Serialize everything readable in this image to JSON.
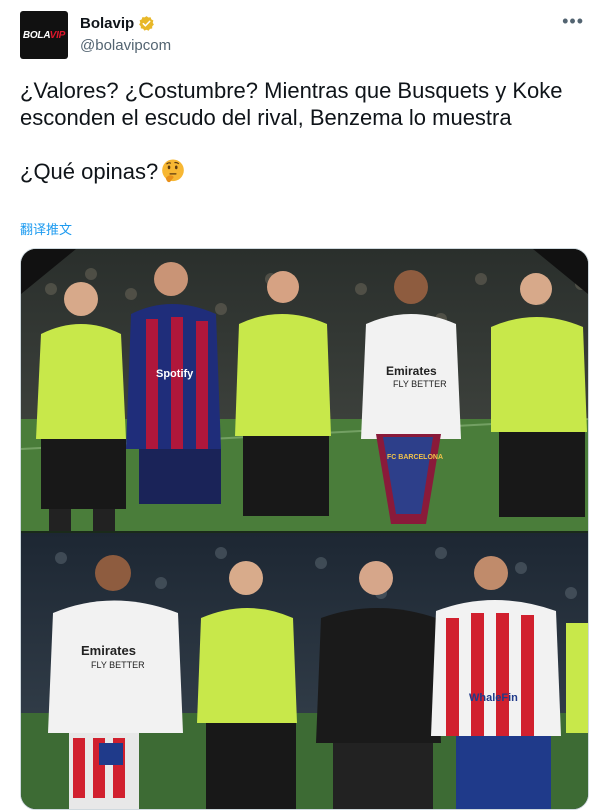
{
  "author": {
    "name": "Bolavip",
    "handle": "@bolavipcom",
    "avatar_text_a": "BOLA",
    "avatar_text_b": "VIP"
  },
  "tweet": {
    "text": "¿Valores? ¿Costumbre? Mientras que Busquets y Koke esconden el escudo del rival, Benzema lo muestra\n\n¿Qué opinas?",
    "translate_label": "翻译推文"
  },
  "icons": {
    "verified": "verified-badge-icon",
    "more": "more-options-icon",
    "emoji": "thinking-face-emoji"
  },
  "media": {
    "top_kits": {
      "referee_left_badge": "",
      "busquets_sponsor": "Spotify",
      "benzema_sponsor_a": "Emirates",
      "benzema_sponsor_b": "FLY BETTER",
      "pennant_text": "FC BARCELONA"
    },
    "bottom_kits": {
      "benzema_sponsor_a": "Emirates",
      "benzema_sponsor_b": "FLY BETTER",
      "koke_sponsor": "WhaleFin"
    }
  },
  "colors": {
    "link": "#1d9bf0",
    "secondary_text": "#536471",
    "border": "#cfd9de",
    "verified_gold": "#e8b829",
    "referee_yellow": "#c8e84a"
  }
}
